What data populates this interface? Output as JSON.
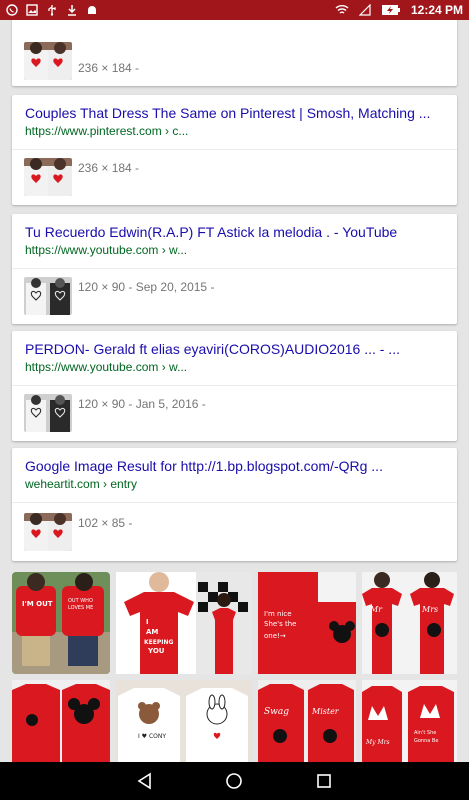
{
  "status_bar": {
    "time": "12:24 PM",
    "icons": [
      "whatsapp-icon",
      "image-icon",
      "usb-icon",
      "download-icon",
      "android-icon",
      "wifi-icon",
      "no-sim-icon",
      "battery-charging-icon"
    ]
  },
  "results": [
    {
      "meta": "236 × 184 -"
    },
    {
      "title": "Couples That Dress The Same on Pinterest | Smosh, Matching ...",
      "url": "https://www.pinterest.com › c...",
      "meta": "236 × 184 -"
    },
    {
      "title": "Tu Recuerdo Edwin(R.A.P) FT Astick la melodia . - YouTube",
      "url": "https://www.youtube.com › w...",
      "meta": "120 × 90 - Sep 20, 2015 -"
    },
    {
      "title": "PERDON- Gerald ft elias eyaviri(COROS)AUDIO2016 ... - ...",
      "url": "https://www.youtube.com › w...",
      "meta": "120 × 90 - Jan 5, 2016 -"
    },
    {
      "title": "Google Image Result for http://1.bp.blogspot.com/-QRg ...",
      "url": "weheartit.com › entry",
      "meta": "102 × 85 -"
    }
  ],
  "tiles": [
    {
      "text": "I'M OUT · OUT WHO LOVES ME"
    },
    {
      "text": "I AM KEEPING YOU"
    },
    {
      "text": "I'm nice She's the"
    },
    {
      "text": "Mr · Mrs"
    },
    {
      "text": ""
    },
    {
      "text": "I ♥ CONY"
    },
    {
      "text": "Swag · Mister"
    },
    {
      "text": "Ain't She Gonna Be My Mrs"
    }
  ],
  "colors": {
    "status_bar": "#a0161b",
    "link": "#1a0dab",
    "url": "#006621",
    "meta": "#757575",
    "shirt_red": "#d9181f"
  }
}
